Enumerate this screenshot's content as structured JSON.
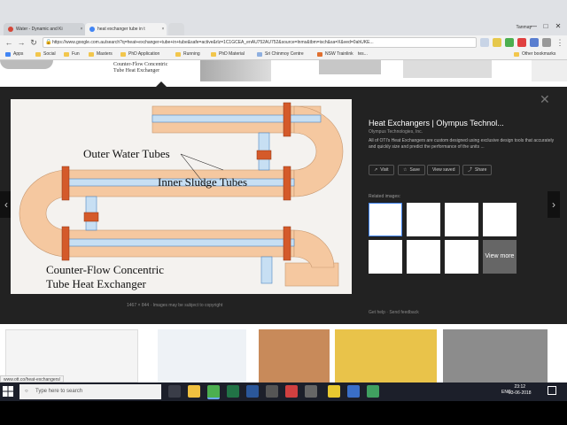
{
  "browser": {
    "tabs": [
      {
        "label": "Water - Dynamic and Ki",
        "favicon_color": "#d44638"
      },
      {
        "label": "heat exchanger tube in t",
        "favicon_color": "#4285f4"
      }
    ],
    "user": "Tanmay",
    "window_buttons": [
      "—",
      "□",
      "✕"
    ],
    "url": "https://www.google.com.au/search?q=heat+exchanger+tube+in+tube&safe=active&rlz=1C1GCEA_enAU752AU752&source=lnms&tbm=isch&sa=X&ved=0ahUKE...",
    "bookmarks": [
      "Apps",
      "Social",
      "Fun",
      "Masters",
      "PhD Application",
      "Running",
      "PhD Material",
      "Sri Chinmoy Centre",
      "NSW Trainlink",
      "tes..."
    ],
    "other_bookmarks": "Other bookmarks"
  },
  "image_viewer": {
    "main_image": {
      "labels": [
        "Outer Water Tubes",
        "Inner Sludge Tubes",
        "Counter-Flow Concentric",
        "Tube Heat Exchanger"
      ]
    },
    "caption_size": "1467 × 844",
    "caption_note": "Images may be subject to copyright",
    "title": "Heat Exchangers | Olympus Technol...",
    "site": "Olympus Technologies, Inc.",
    "description": "All of OTI's Heat Exchangers are custom designed using exclusive design tools that accurately and quickly size and predict the performance of the units ...",
    "buttons": [
      "Visit",
      "Save",
      "View saved",
      "Share"
    ],
    "related_label": "Related images:",
    "view_more": "View more",
    "footer": "Get help · Send feedback"
  },
  "top_strip_text": [
    "Counter-Flow Concentric",
    "Tube Heat Exchanger"
  ],
  "status_url": "www.ott.co/heat-exchangers/",
  "taskbar": {
    "search_placeholder": "Type here to search",
    "lang": "ENG",
    "time": "23:12",
    "date": "03-06-2018"
  }
}
